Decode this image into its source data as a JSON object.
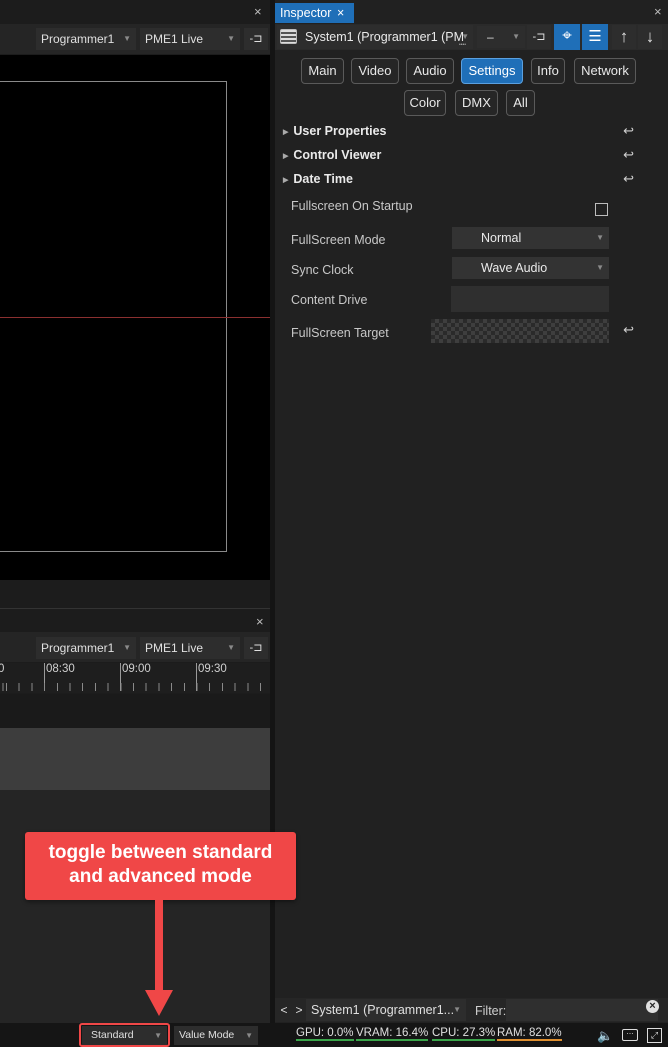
{
  "colors": {
    "accent": "#1f6fb8",
    "callout": "#f04747",
    "stat_underline_green": "#3aa64a",
    "stat_underline_orange": "#e09030"
  },
  "preview": {
    "programmer_select": "Programmer1",
    "live_select": "PME1 Live",
    "close_icon": "×"
  },
  "timeline": {
    "programmer_select": "Programmer1",
    "live_select": "PME1 Live",
    "close_icon": "×",
    "ticks": [
      "08:30",
      "09:00",
      "09:30"
    ],
    "partial_tick": "0"
  },
  "inspector": {
    "tab_title": "Inspector",
    "tab_close": "×",
    "object_select": "System1 (Programmer1 (PM",
    "minus_select": "–",
    "more_dots": "••••",
    "tabs": [
      "Main",
      "Video",
      "Audio",
      "Settings",
      "Info",
      "Network",
      "Color",
      "DMX",
      "All"
    ],
    "active_tab": "Settings",
    "groups": [
      "User Properties",
      "Control Viewer",
      "Date Time"
    ],
    "properties": {
      "fullscreen_on_startup": "Fullscreen On Startup",
      "fullscreen_mode_label": "FullScreen Mode",
      "fullscreen_mode_value": "Normal",
      "sync_clock_label": "Sync Clock",
      "sync_clock_value": "Wave Audio",
      "content_drive_label": "Content Drive",
      "fullscreen_target_label": "FullScreen Target"
    },
    "return_glyph": "↩",
    "footer": {
      "prev": "<",
      "next": ">",
      "object": "System1 (Programmer1...",
      "filter_label": "Filter:"
    }
  },
  "statusbar": {
    "mode": "Standard",
    "value_mode": "Value Mode",
    "gpu": "GPU: 0.0%",
    "vram": "VRAM: 16.4%",
    "cpu": "CPU: 27.3%",
    "ram": "RAM: 82.0%"
  },
  "callout": {
    "line1": "toggle between standard",
    "line2": "and advanced mode"
  }
}
